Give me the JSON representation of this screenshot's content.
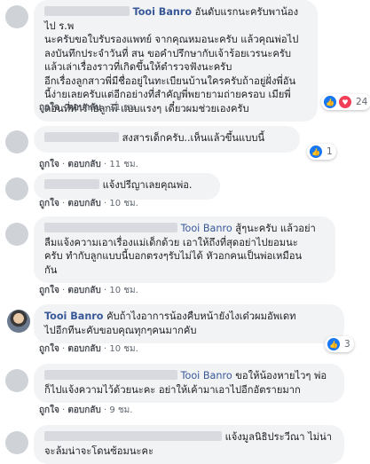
{
  "reaction_icons": {
    "like": "thumbs-up-icon",
    "love": "heart-icon",
    "like_color": "#1877f2",
    "love_color": "#f33e58"
  },
  "colors": {
    "name": "#385898",
    "bubble": "#f2f3f5"
  },
  "comments": [
    {
      "author_visible": "Tooi Banro",
      "lines": [
        "Tooi Banro อันดับแรกนะครับพาน้องไป ร.พ",
        "นะครับขอใบรับรองแพทย์ จากคุณหมอนะครับ แล้วคุณพ่อไป",
        "ลงบันทึกประจำวันที่ สน ขอคำปรึกษากับเจ้าร้อยเวรนะครับ",
        "แล้วเล่าเรื่องราวที่เกิดขึ้นให้ตำรวจฟังนะครับ",
        "อีกเรื่องลูกสาวพี่มีชื่ออยู่ในทะเบียนบ้านใครครับถ้าอยู่ฝั่งพี่อัน",
        "นี้ง่ายเลยครับแต่อีกอย่างที่สำคัญพี่พยายามถ่ายครอบ เมียพี่",
        "ตอนที่ทำร้ายลูกพี่ แบบแรงๆ เดี๋ยวผมช่วยเองครับ"
      ],
      "like_label": "ถูกใจ",
      "reply_label": "ตอบกลับ",
      "time": "11 ชม.",
      "reaction_count": "24"
    },
    {
      "text": "สงสารเด็กครับ..เห็นแล้วขึ้นแบบนี้",
      "like_label": "ถูกใจ",
      "reply_label": "ตอบกลับ",
      "time": "11 ชม.",
      "reaction_count": "1"
    },
    {
      "text": "แจ้งปรีญาเลยคุณพ่อ.",
      "like_label": "ถูกใจ",
      "reply_label": "ตอบกลับ",
      "time": "10 ชม."
    },
    {
      "mention": "Tooi Banro",
      "lines": [
        "สู้ๆนะครับ แล้วอย่า",
        "ลืมแจ้งความเอาเรื่องแม่เด็กด้วย เอาให้ถึงที่สุดอย่าไปยอมนะ",
        "ครับ ทำกับลูกแบบนี้บอกตรงๆรับไม่ได้ หัวอกคนเป็นพ่อเหมือน",
        "กัน"
      ],
      "like_label": "ถูกใจ",
      "reply_label": "ตอบกลับ",
      "time": "10 ชม."
    },
    {
      "author": "Tooi Banro",
      "lines": [
        "คับถ้าไงอาการน้องคืบหน้ายังไงเด๋วผมอัพเดท",
        "ไปอีกทีนะคับขอบคุณทุกๆคนมากคับ"
      ],
      "like_label": "ถูกใจ",
      "reply_label": "ตอบกลับ",
      "time": "10 ชม.",
      "reaction_count": "3"
    },
    {
      "mention": "Tooi Banro",
      "lines": [
        "ขอให้น้องหายไวๆ พ่อ",
        "ก็ไปแจ้งความไว้ด้วยนะคะ อย่าให้เค้ามาเอาไปอีกอัตรายมาก"
      ],
      "like_label": "ถูกใจ",
      "reply_label": "ตอบกลับ",
      "time": "9 ชม."
    },
    {
      "lines": [
        "แจ้งมูลนิธิประวีณา ไม่น่า",
        "จะล้มน่าจะโดนซ้อมนะคะ"
      ]
    }
  ]
}
